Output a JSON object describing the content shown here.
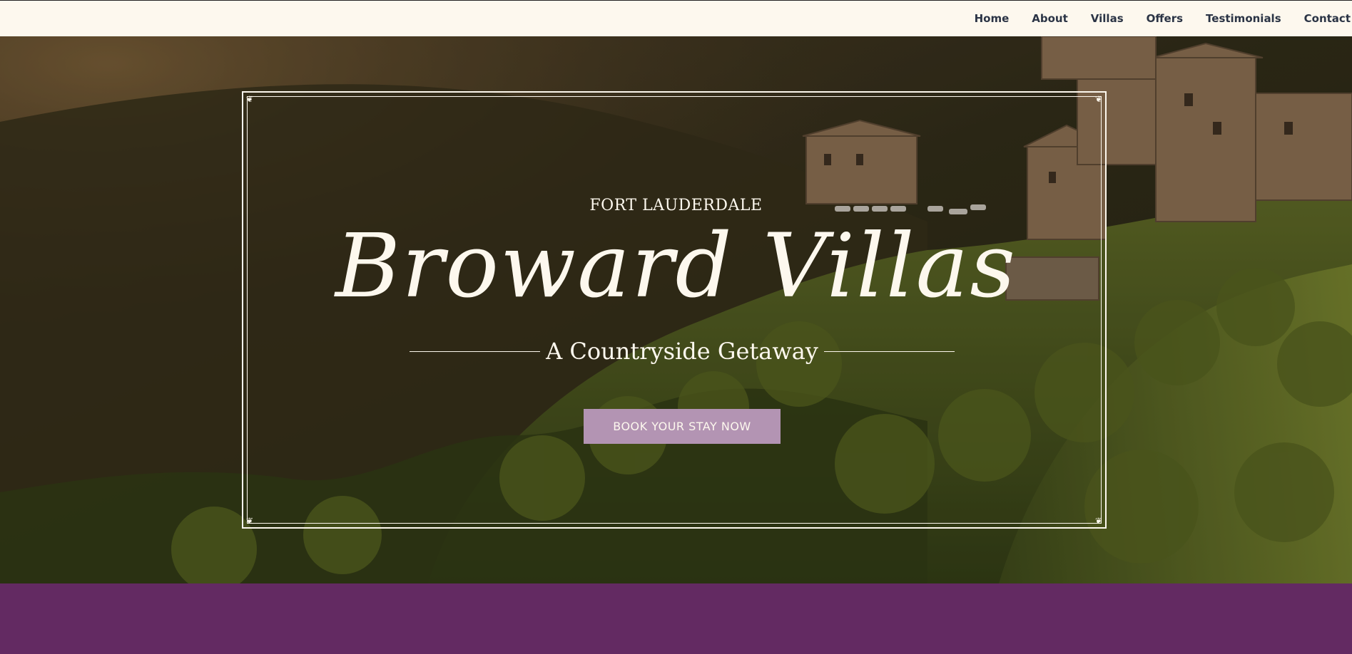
{
  "nav": {
    "items": [
      {
        "label": "Home"
      },
      {
        "label": "About"
      },
      {
        "label": "Villas"
      },
      {
        "label": "Offers"
      },
      {
        "label": "Testimonials"
      },
      {
        "label": "Contact"
      }
    ]
  },
  "hero": {
    "location": "FORT LAUDERDALE",
    "title": "Broward Villas",
    "subtitle": "A Countryside Getaway",
    "cta_label": "BOOK YOUR STAY NOW"
  },
  "colors": {
    "nav_background": "#fdf8ee",
    "nav_text": "#2b3445",
    "cream_text": "#fdf8ee",
    "cta_background": "#b394b3",
    "band_purple": "#632a62"
  }
}
